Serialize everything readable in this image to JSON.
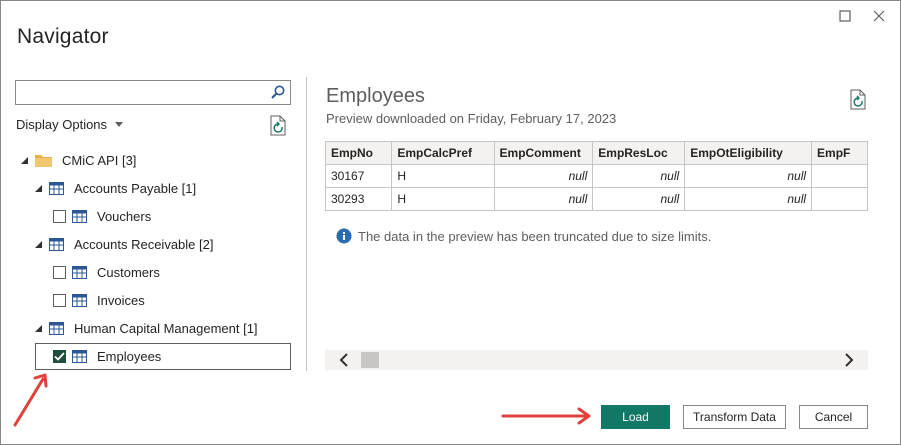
{
  "window": {
    "title": "Navigator",
    "controls": [
      {
        "name": "maximize",
        "icon": "maximize-icon"
      },
      {
        "name": "close",
        "icon": "close-icon"
      }
    ]
  },
  "left": {
    "search": {
      "value": "",
      "placeholder": ""
    },
    "display_options": "Display Options",
    "tree": {
      "root": "CMiC API [3]",
      "groups": [
        {
          "label": "Accounts Payable [1]",
          "items": [
            {
              "label": "Vouchers",
              "checked": false
            }
          ]
        },
        {
          "label": "Accounts Receivable [2]",
          "items": [
            {
              "label": "Customers",
              "checked": false
            },
            {
              "label": "Invoices",
              "checked": false
            }
          ]
        },
        {
          "label": "Human Capital Management [1]",
          "items": [
            {
              "label": "Employees",
              "checked": true
            }
          ]
        }
      ]
    }
  },
  "preview": {
    "title": "Employees",
    "subtitle": "Preview downloaded on Friday, February 17, 2023",
    "columns": [
      "EmpNo",
      "EmpCalcPref",
      "EmpComment",
      "EmpResLoc",
      "EmpOtEligibility",
      "EmpF"
    ],
    "rows": [
      [
        "30167",
        "H",
        "null",
        "null",
        "null",
        ""
      ],
      [
        "30293",
        "H",
        "null",
        "null",
        "null",
        ""
      ]
    ],
    "info": "The data in the preview has been truncated due to size limits."
  },
  "buttons": {
    "load": "Load",
    "transform": "Transform Data",
    "cancel": "Cancel"
  },
  "colors": {
    "primary": "#117865",
    "checked": "#1f4e3d",
    "annotation_arrow": "#e0413a",
    "info_icon": "#2b6cb0"
  }
}
